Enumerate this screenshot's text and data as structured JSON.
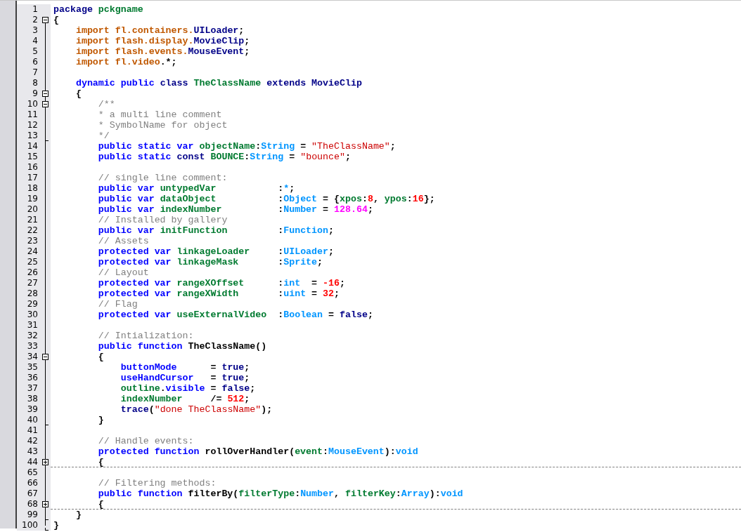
{
  "editor": {
    "lines": [
      {
        "number": "1",
        "kind": "plain",
        "tokens": [
          {
            "kind": "k2",
            "text": "package "
          },
          {
            "kind": "id",
            "text": "pckgname"
          }
        ]
      },
      {
        "number": "2",
        "kind": "fold-open",
        "tokens": [
          {
            "kind": "p",
            "text": "{"
          }
        ]
      },
      {
        "number": "3",
        "kind": "plain",
        "tokens": [
          {
            "kind": "imp",
            "text": "    import fl.containers."
          },
          {
            "kind": "k2",
            "text": "UILoader"
          },
          {
            "kind": "p",
            "text": ";"
          }
        ]
      },
      {
        "number": "4",
        "kind": "plain",
        "tokens": [
          {
            "kind": "imp",
            "text": "    import flash.display."
          },
          {
            "kind": "k2",
            "text": "MovieClip"
          },
          {
            "kind": "p",
            "text": ";"
          }
        ]
      },
      {
        "number": "5",
        "kind": "plain",
        "tokens": [
          {
            "kind": "imp",
            "text": "    import flash.events."
          },
          {
            "kind": "k2",
            "text": "MouseEvent"
          },
          {
            "kind": "p",
            "text": ";"
          }
        ]
      },
      {
        "number": "6",
        "kind": "plain",
        "tokens": [
          {
            "kind": "imp",
            "text": "    import fl.video"
          },
          {
            "kind": "p",
            "text": ".*;"
          }
        ]
      },
      {
        "number": "7",
        "kind": "plain"
      },
      {
        "number": "8",
        "kind": "plain",
        "tokens": [
          {
            "kind": "k",
            "text": "    dynamic public "
          },
          {
            "kind": "k2",
            "text": "class "
          },
          {
            "kind": "id",
            "text": "TheClassName "
          },
          {
            "kind": "k2",
            "text": "extends MovieClip"
          }
        ]
      },
      {
        "number": "9",
        "kind": "fold-open",
        "tokens": [
          {
            "kind": "p",
            "text": "    {"
          }
        ]
      },
      {
        "number": "10",
        "kind": "fold-open",
        "tokens": [
          {
            "kind": "com",
            "text": "        /**"
          }
        ]
      },
      {
        "number": "11",
        "kind": "plain",
        "tokens": [
          {
            "kind": "com",
            "text": "        * a multi line comment"
          }
        ]
      },
      {
        "number": "12",
        "kind": "plain",
        "tokens": [
          {
            "kind": "com",
            "text": "        * SymbolName for object"
          }
        ]
      },
      {
        "number": "13",
        "kind": "fold-end",
        "tokens": [
          {
            "kind": "com",
            "text": "        */"
          }
        ]
      },
      {
        "number": "14",
        "kind": "plain",
        "tokens": [
          {
            "kind": "k",
            "text": "        public static var "
          },
          {
            "kind": "id",
            "text": "objectName"
          },
          {
            "kind": "p",
            "text": ":"
          },
          {
            "kind": "type",
            "text": "String"
          },
          {
            "kind": "p",
            "text": " = "
          },
          {
            "kind": "str",
            "text": "\"TheClassName\""
          },
          {
            "kind": "p",
            "text": ";"
          }
        ]
      },
      {
        "number": "15",
        "kind": "plain",
        "tokens": [
          {
            "kind": "k",
            "text": "        public static "
          },
          {
            "kind": "k2",
            "text": "const "
          },
          {
            "kind": "id",
            "text": "BOUNCE"
          },
          {
            "kind": "p",
            "text": ":"
          },
          {
            "kind": "type",
            "text": "String"
          },
          {
            "kind": "p",
            "text": " = "
          },
          {
            "kind": "str",
            "text": "\"bounce\""
          },
          {
            "kind": "p",
            "text": ";"
          }
        ]
      },
      {
        "number": "16",
        "kind": "plain"
      },
      {
        "number": "17",
        "kind": "plain",
        "tokens": [
          {
            "kind": "com",
            "text": "        // single line comment:"
          }
        ]
      },
      {
        "number": "18",
        "kind": "plain",
        "tokens": [
          {
            "kind": "k",
            "text": "        public var "
          },
          {
            "kind": "id",
            "text": "untypedVar"
          },
          {
            "kind": "p",
            "text": "           :"
          },
          {
            "kind": "type",
            "text": "*"
          },
          {
            "kind": "p",
            "text": ";"
          }
        ]
      },
      {
        "number": "19",
        "kind": "plain",
        "tokens": [
          {
            "kind": "k",
            "text": "        public var "
          },
          {
            "kind": "id",
            "text": "dataObject"
          },
          {
            "kind": "p",
            "text": "           :"
          },
          {
            "kind": "type",
            "text": "Object"
          },
          {
            "kind": "p",
            "text": " = {"
          },
          {
            "kind": "id",
            "text": "xpos"
          },
          {
            "kind": "p",
            "text": ":"
          },
          {
            "kind": "num",
            "text": "8"
          },
          {
            "kind": "p",
            "text": ", "
          },
          {
            "kind": "id",
            "text": "ypos"
          },
          {
            "kind": "p",
            "text": ":"
          },
          {
            "kind": "num",
            "text": "16"
          },
          {
            "kind": "p",
            "text": "};"
          }
        ]
      },
      {
        "number": "20",
        "kind": "plain",
        "tokens": [
          {
            "kind": "k",
            "text": "        public var "
          },
          {
            "kind": "id",
            "text": "indexNumber"
          },
          {
            "kind": "p",
            "text": "          :"
          },
          {
            "kind": "type",
            "text": "Number"
          },
          {
            "kind": "p",
            "text": " = "
          },
          {
            "kind": "mag",
            "text": "128.64"
          },
          {
            "kind": "p",
            "text": ";"
          }
        ]
      },
      {
        "number": "21",
        "kind": "plain",
        "tokens": [
          {
            "kind": "com",
            "text": "        // Installed by gallery"
          }
        ]
      },
      {
        "number": "22",
        "kind": "plain",
        "tokens": [
          {
            "kind": "k",
            "text": "        public var "
          },
          {
            "kind": "id",
            "text": "initFunction"
          },
          {
            "kind": "p",
            "text": "         :"
          },
          {
            "kind": "type",
            "text": "Function"
          },
          {
            "kind": "p",
            "text": ";"
          }
        ]
      },
      {
        "number": "23",
        "kind": "plain",
        "tokens": [
          {
            "kind": "com",
            "text": "        // Assets"
          }
        ]
      },
      {
        "number": "24",
        "kind": "plain",
        "tokens": [
          {
            "kind": "k",
            "text": "        protected var "
          },
          {
            "kind": "id",
            "text": "linkageLoader"
          },
          {
            "kind": "p",
            "text": "     :"
          },
          {
            "kind": "type",
            "text": "UILoader"
          },
          {
            "kind": "p",
            "text": ";"
          }
        ]
      },
      {
        "number": "25",
        "kind": "plain",
        "tokens": [
          {
            "kind": "k",
            "text": "        protected var "
          },
          {
            "kind": "id",
            "text": "linkageMask"
          },
          {
            "kind": "p",
            "text": "       :"
          },
          {
            "kind": "type",
            "text": "Sprite"
          },
          {
            "kind": "p",
            "text": ";"
          }
        ]
      },
      {
        "number": "26",
        "kind": "plain",
        "tokens": [
          {
            "kind": "com",
            "text": "        // Layout"
          }
        ]
      },
      {
        "number": "27",
        "kind": "plain",
        "tokens": [
          {
            "kind": "k",
            "text": "        protected var "
          },
          {
            "kind": "id",
            "text": "rangeXOffset"
          },
          {
            "kind": "p",
            "text": "      :"
          },
          {
            "kind": "type",
            "text": "int"
          },
          {
            "kind": "p",
            "text": "  = "
          },
          {
            "kind": "num",
            "text": "-16"
          },
          {
            "kind": "p",
            "text": ";"
          }
        ]
      },
      {
        "number": "28",
        "kind": "plain",
        "tokens": [
          {
            "kind": "k",
            "text": "        protected var "
          },
          {
            "kind": "id",
            "text": "rangeXWidth"
          },
          {
            "kind": "p",
            "text": "       :"
          },
          {
            "kind": "type",
            "text": "uint"
          },
          {
            "kind": "p",
            "text": " = "
          },
          {
            "kind": "num",
            "text": "32"
          },
          {
            "kind": "p",
            "text": ";"
          }
        ]
      },
      {
        "number": "29",
        "kind": "plain",
        "tokens": [
          {
            "kind": "com",
            "text": "        // Flag"
          }
        ]
      },
      {
        "number": "30",
        "kind": "plain",
        "tokens": [
          {
            "kind": "k",
            "text": "        protected var "
          },
          {
            "kind": "id",
            "text": "useExternalVideo"
          },
          {
            "kind": "p",
            "text": "  :"
          },
          {
            "kind": "type",
            "text": "Boolean"
          },
          {
            "kind": "p",
            "text": " = "
          },
          {
            "kind": "k2",
            "text": "false"
          },
          {
            "kind": "p",
            "text": ";"
          }
        ]
      },
      {
        "number": "31",
        "kind": "plain"
      },
      {
        "number": "32",
        "kind": "plain",
        "tokens": [
          {
            "kind": "com",
            "text": "        // Intialization:"
          }
        ]
      },
      {
        "number": "33",
        "kind": "plain",
        "tokens": [
          {
            "kind": "k",
            "text": "        public function "
          },
          {
            "kind": "p",
            "text": "TheClassName()"
          }
        ]
      },
      {
        "number": "34",
        "kind": "fold-open",
        "tokens": [
          {
            "kind": "p",
            "text": "        {"
          }
        ]
      },
      {
        "number": "35",
        "kind": "plain",
        "tokens": [
          {
            "kind": "k",
            "text": "            buttonMode"
          },
          {
            "kind": "p",
            "text": "      = "
          },
          {
            "kind": "k2",
            "text": "true"
          },
          {
            "kind": "p",
            "text": ";"
          }
        ]
      },
      {
        "number": "36",
        "kind": "plain",
        "tokens": [
          {
            "kind": "k",
            "text": "            useHandCursor"
          },
          {
            "kind": "p",
            "text": "   = "
          },
          {
            "kind": "k2",
            "text": "true"
          },
          {
            "kind": "p",
            "text": ";"
          }
        ]
      },
      {
        "number": "37",
        "kind": "plain",
        "tokens": [
          {
            "kind": "id",
            "text": "            outline"
          },
          {
            "kind": "p",
            "text": "."
          },
          {
            "kind": "k",
            "text": "visible"
          },
          {
            "kind": "p",
            "text": " = "
          },
          {
            "kind": "k2",
            "text": "false"
          },
          {
            "kind": "p",
            "text": ";"
          }
        ]
      },
      {
        "number": "38",
        "kind": "plain",
        "tokens": [
          {
            "kind": "id",
            "text": "            indexNumber"
          },
          {
            "kind": "p",
            "text": "     /= "
          },
          {
            "kind": "num",
            "text": "512"
          },
          {
            "kind": "p",
            "text": ";"
          }
        ]
      },
      {
        "number": "39",
        "kind": "plain",
        "tokens": [
          {
            "kind": "k2",
            "text": "            trace"
          },
          {
            "kind": "p",
            "text": "("
          },
          {
            "kind": "str",
            "text": "\"done TheClassName\""
          },
          {
            "kind": "p",
            "text": ");"
          }
        ]
      },
      {
        "number": "40",
        "kind": "fold-end",
        "tokens": [
          {
            "kind": "p",
            "text": "        }"
          }
        ]
      },
      {
        "number": "41",
        "kind": "plain"
      },
      {
        "number": "42",
        "kind": "plain",
        "tokens": [
          {
            "kind": "com",
            "text": "        // Handle events:"
          }
        ]
      },
      {
        "number": "43",
        "kind": "plain",
        "tokens": [
          {
            "kind": "k",
            "text": "        protected function "
          },
          {
            "kind": "p",
            "text": "rollOverHandler("
          },
          {
            "kind": "id",
            "text": "event"
          },
          {
            "kind": "p",
            "text": ":"
          },
          {
            "kind": "type",
            "text": "MouseEvent"
          },
          {
            "kind": "p",
            "text": "):"
          },
          {
            "kind": "type",
            "text": "void"
          }
        ]
      },
      {
        "number": "44",
        "kind": "folded",
        "tokens": [
          {
            "kind": "p",
            "text": "        {"
          }
        ]
      },
      {
        "number": "65",
        "kind": "plain"
      },
      {
        "number": "66",
        "kind": "plain",
        "tokens": [
          {
            "kind": "com",
            "text": "        // Filtering methods:"
          }
        ]
      },
      {
        "number": "67",
        "kind": "plain",
        "tokens": [
          {
            "kind": "k",
            "text": "        public function "
          },
          {
            "kind": "p",
            "text": "filterBy("
          },
          {
            "kind": "id",
            "text": "filterType"
          },
          {
            "kind": "p",
            "text": ":"
          },
          {
            "kind": "type",
            "text": "Number"
          },
          {
            "kind": "p",
            "text": ", "
          },
          {
            "kind": "id",
            "text": "filterKey"
          },
          {
            "kind": "p",
            "text": ":"
          },
          {
            "kind": "type",
            "text": "Array"
          },
          {
            "kind": "p",
            "text": "):"
          },
          {
            "kind": "type",
            "text": "void"
          }
        ]
      },
      {
        "number": "68",
        "kind": "folded",
        "tokens": [
          {
            "kind": "p",
            "text": "        {"
          }
        ]
      },
      {
        "number": "99",
        "kind": "fold-end",
        "tokens": [
          {
            "kind": "p",
            "text": "    }"
          }
        ]
      },
      {
        "number": "100",
        "kind": "fold-end",
        "tokens": [
          {
            "kind": "p",
            "text": "}"
          }
        ]
      }
    ]
  }
}
